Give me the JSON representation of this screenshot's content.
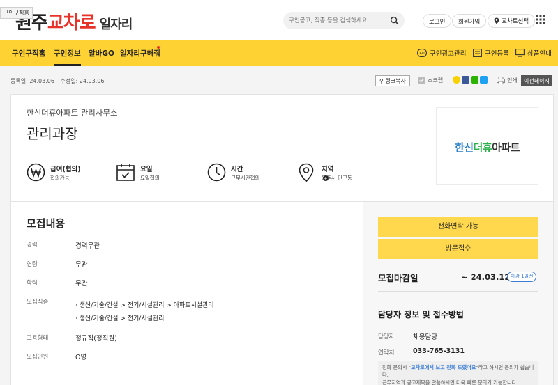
{
  "header": {
    "tooltip": "구인구직홈",
    "logo_part1": "원주",
    "logo_part2": "교차로",
    "logo_part3": "일자리",
    "search_placeholder": "구인공고, 직종 등을 검색하세요",
    "login": "로그인",
    "signup": "회원가입",
    "region": "교차로선택"
  },
  "nav": {
    "items": [
      "구인구직홈",
      "구인정보",
      "알바GO",
      "일자리구해줘"
    ],
    "right": [
      "구인광고관리",
      "구인등록",
      "상품안내"
    ]
  },
  "toolbar": {
    "registered": "등록일: 24.03.06",
    "modified": "수정일: 24.03.06",
    "copy_link": "링크복사",
    "scrap": "스크랩",
    "print": "인쇄",
    "prev_page": "이전페이지"
  },
  "job": {
    "company": "한신더휴아파트 관리사무소",
    "title": "관리과장",
    "logo_text_a": "한신",
    "logo_text_b": "더휴",
    "logo_text_c": "아파트",
    "conditions": [
      {
        "label": "급여(협의)",
        "value": "협의가능"
      },
      {
        "label": "요일",
        "value": "요일협의"
      },
      {
        "label": "시간",
        "value": "근무시간협의"
      },
      {
        "label": "지역",
        "value": "원주시 단구동"
      }
    ]
  },
  "recruit": {
    "title": "모집내용",
    "career_label": "경력",
    "career_value": "경력무관",
    "age_label": "연령",
    "age_value": "무관",
    "edu_label": "학력",
    "edu_value": "무관",
    "job_label": "모집직종",
    "jobs": [
      "· 생산/기술/건설 > 전기/시설관리 > 아파트시설관리",
      "· 생산/기술/건설 > 전기/시설관리"
    ],
    "emp_label": "고용형태",
    "emp_value": "정규직(정직원)",
    "count_label": "모집인원",
    "count_value": "O명"
  },
  "side": {
    "call_btn": "전화연락 가능",
    "visit_btn": "방문접수",
    "deadline_label": "모집마감일",
    "deadline_value": "~ 24.03.12",
    "dday": "마감 1일전",
    "contact_title": "담당자 정보 및 접수방법",
    "manager_label": "담당자",
    "manager_value": "채용담당",
    "phone_label": "연락처",
    "phone_value": "033-765-3131",
    "note_pre": "전화 문의시 \"",
    "note_bold": "교차로에서 보고 전화 드렸어요",
    "note_post": "\"라고 하시면 문의가 쉽습니다.",
    "note_line2": "근무지역과 공고제목을 말씀하시면 더욱 빠른 문의가 가능합니다."
  }
}
